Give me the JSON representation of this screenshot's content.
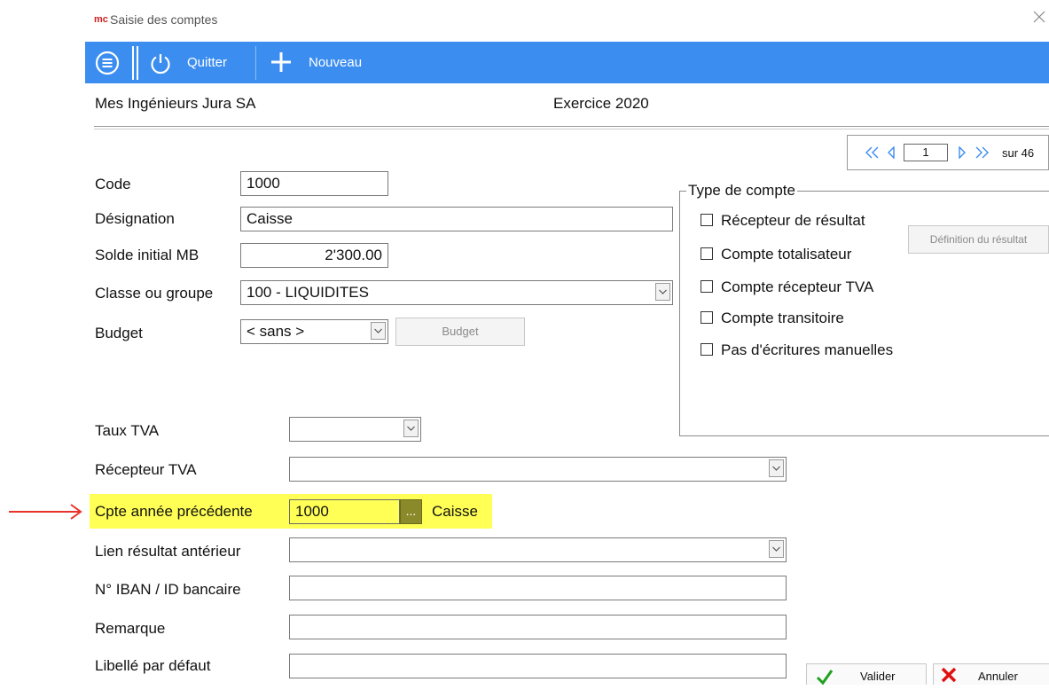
{
  "window": {
    "title": "Saisie des comptes",
    "app_logo": "mc"
  },
  "toolbar": {
    "menu_icon": "menu-icon",
    "quit_label": "Quitter",
    "new_label": "Nouveau"
  },
  "header": {
    "company": "Mes Ingénieurs Jura SA",
    "exercise": "Exercice 2020"
  },
  "pager": {
    "current": "1",
    "total_label": "sur 46"
  },
  "form": {
    "code_label": "Code",
    "code_value": "1000",
    "designation_label": "Désignation",
    "designation_value": "Caisse",
    "solde_label": "Solde initial MB",
    "solde_value": "2'300.00",
    "classe_label": "Classe ou groupe",
    "classe_value": "100 - LIQUIDITES",
    "budget_label": "Budget",
    "budget_value": "< sans >",
    "budget_button": "Budget",
    "taux_tva_label": "Taux TVA",
    "taux_tva_value": "",
    "recepteur_tva_label": "Récepteur TVA",
    "recepteur_tva_value": "",
    "cpte_prec_label": "Cpte année précédente",
    "cpte_prec_value": "1000",
    "cpte_prec_button": "...",
    "cpte_prec_name": "Caisse",
    "lien_label": "Lien résultat antérieur",
    "lien_value": "",
    "iban_label": "N° IBAN / ID bancaire",
    "iban_value": "",
    "remarque_label": "Remarque",
    "remarque_value": "",
    "libelle_label": "Libellé par défaut",
    "libelle_value": ""
  },
  "type_compte": {
    "legend": "Type de compte",
    "options": [
      {
        "label": "Récepteur de résultat",
        "checked": false
      },
      {
        "label": "Compte totalisateur",
        "checked": false
      },
      {
        "label": "Compte récepteur TVA",
        "checked": false
      },
      {
        "label": "Compte transitoire",
        "checked": false
      },
      {
        "label": "Pas d'écritures manuelles",
        "checked": false
      }
    ],
    "definition_button": "Définition du résultat"
  },
  "footer": {
    "valider_label": "Valider",
    "annuler_label": "Annuler"
  },
  "colors": {
    "toolbar": "#3c8df0",
    "highlight": "#ffff55",
    "ellipsis_button": "#8a8a2a",
    "arrow": "#e8322a"
  }
}
